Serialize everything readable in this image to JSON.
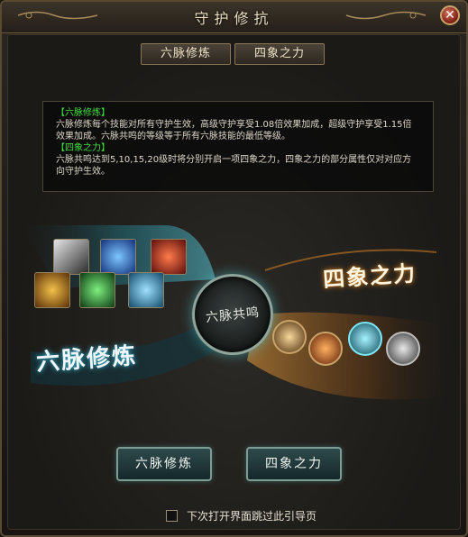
{
  "window": {
    "title": "守护修抗",
    "close_glyph": "✕"
  },
  "tabs": [
    {
      "label": "六脉修炼"
    },
    {
      "label": "四象之力"
    }
  ],
  "info": {
    "section1_head": "【六脉修炼】",
    "section1_text": "六脉修炼每个技能对所有守护生效，高级守护享受1.08倍效果加成，超级守护享受1.15倍效果加成。六脉共鸣的等级等于所有六脉技能的最低等级。",
    "section2_head": "【四象之力】",
    "section2_text": "六脉共鸣达到5,10,15,20级时将分别开启一项四象之力，四象之力的部分属性仅对对应方向守护生效。"
  },
  "art": {
    "left_title": "六脉修炼",
    "right_title": "四象之力",
    "center_label": "六脉共鸣",
    "skills": [
      "skill-icon-1",
      "skill-icon-2",
      "skill-icon-3",
      "skill-icon-4",
      "skill-icon-5",
      "skill-icon-6"
    ],
    "orbs": [
      "tiger-orb-icon",
      "phoenix-orb-icon",
      "dragon-orb-icon",
      "tortoise-orb-icon"
    ]
  },
  "buttons": {
    "six_meridian": "六脉修炼",
    "four_symbols": "四象之力"
  },
  "footer": {
    "skip_label": "下次打开界面跳过此引导页"
  },
  "colors": {
    "accent_cyan": "#3fb6d1",
    "accent_gold": "#e08b2a",
    "info_head_green": "#3fe03f"
  }
}
